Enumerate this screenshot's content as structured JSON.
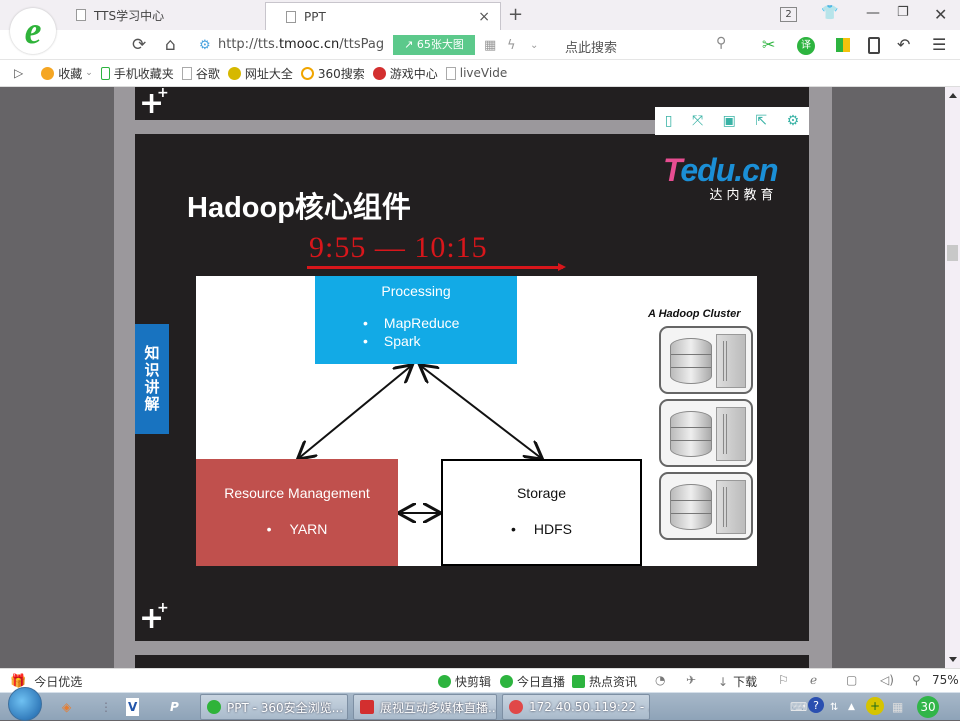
{
  "browser": {
    "tabs": [
      {
        "title": "TTS学习中心",
        "active": false
      },
      {
        "title": "PPT",
        "active": true
      }
    ],
    "tab_count": "2",
    "new_tab_symbol": "+",
    "close_symbol": "×",
    "url_prefix": "http://tts.",
    "url_domain": "tmooc.cn",
    "url_suffix": "/ttsPag",
    "big_image_label": "65张大图",
    "search_placeholder": "点此搜索",
    "translate_label": "译"
  },
  "bookmarks": [
    {
      "label": "收藏",
      "icon": "star-icon",
      "color": "#f5a623"
    },
    {
      "label": "手机收藏夹",
      "icon": "phone-icon",
      "color": "#2db43f"
    },
    {
      "label": "谷歌",
      "icon": "page-icon",
      "color": "#bbbbbb"
    },
    {
      "label": "网址大全",
      "icon": "plus-circle-icon",
      "color": "#d6b800"
    },
    {
      "label": "360搜索",
      "icon": "ring-icon",
      "color": "#f0a500"
    },
    {
      "label": "游戏中心",
      "icon": "game-icon",
      "color": "#d32f2f"
    },
    {
      "label": "liveVide",
      "icon": "page-icon",
      "color": "#bbbbbb"
    }
  ],
  "slide": {
    "title": "Hadoop核心组件",
    "timer": "9:55 — 10:15",
    "brand_top_pink": "T",
    "brand_top_blue": "edu.cn",
    "brand_sub": "达内教育",
    "side_tag": "知识讲解",
    "accent_red": "#d8161b",
    "diagram": {
      "processing": {
        "title": "Processing",
        "items": [
          "MapReduce",
          "Spark"
        ],
        "color": "#12aae6"
      },
      "resource": {
        "title": "Resource Management",
        "items": [
          "YARN"
        ],
        "color": "#c0504d"
      },
      "storage": {
        "title": "Storage",
        "items": [
          "HDFS"
        ]
      },
      "cluster_label": "A Hadoop Cluster",
      "cluster_nodes": 3
    }
  },
  "statusbar": {
    "left": "今日优选",
    "items": [
      "快剪辑",
      "今日直播",
      "热点资讯"
    ],
    "download": "下载",
    "zoom": "75%"
  },
  "taskbar": {
    "tasks": [
      {
        "label": "PPT - 360安全浏览...",
        "icon_color": "#2fb33a"
      },
      {
        "label": "展视互动多媒体直播...",
        "icon_color": "#d32f2f"
      },
      {
        "label": "172.40.50.119:22 - ...",
        "icon_color": "#e04848"
      }
    ],
    "badge": "30"
  }
}
